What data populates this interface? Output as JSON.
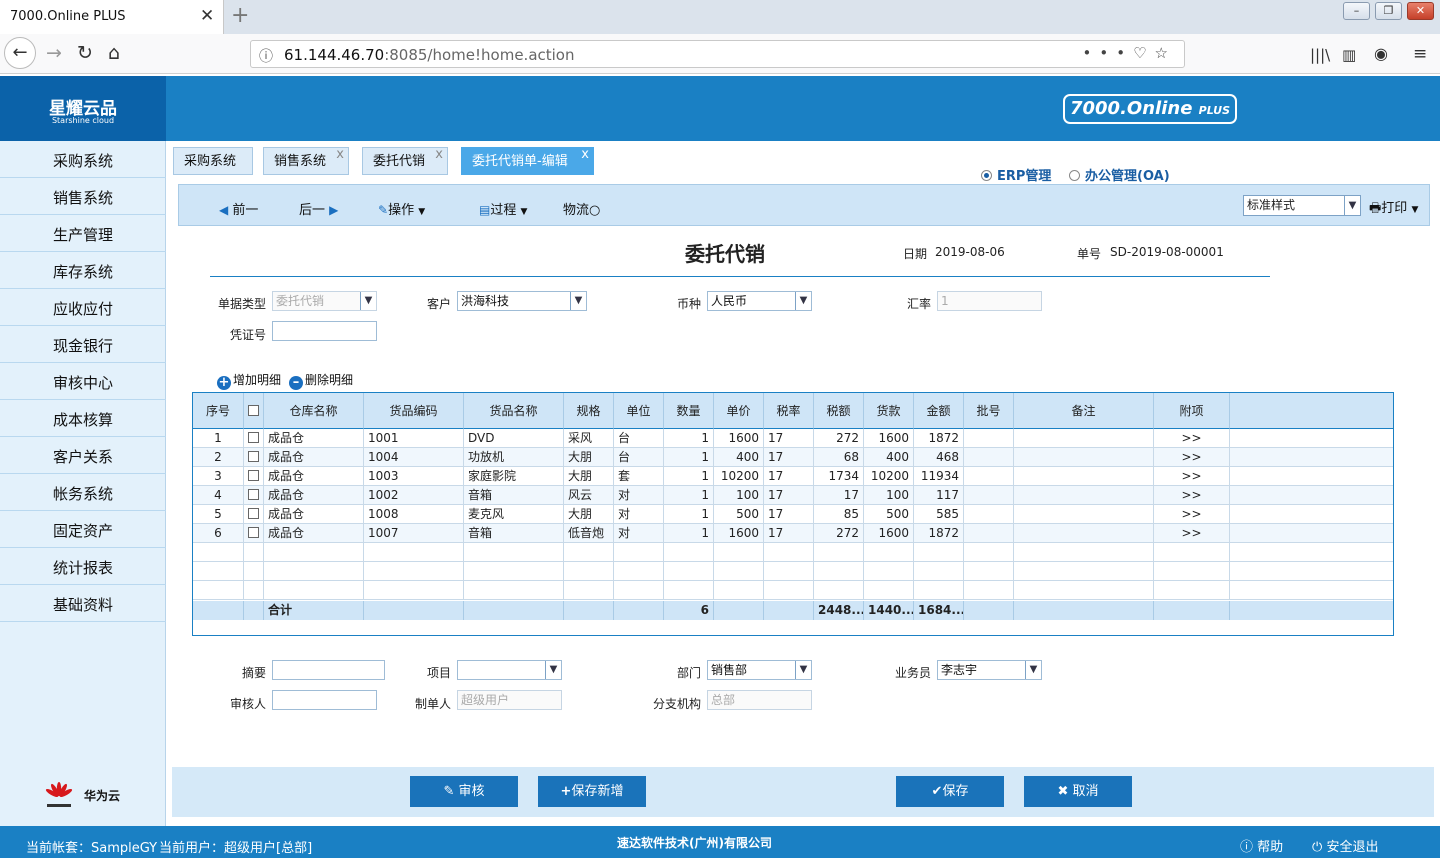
{
  "browser": {
    "tab_title": "7000.Online PLUS",
    "url_host": "61.144.46.70",
    "url_rest": ":8085/home!home.action"
  },
  "app": {
    "logo_cn": "星耀云品",
    "logo_en": "Starshine cloud",
    "brand_main": "7000.Online ",
    "brand_plus": "PLUS"
  },
  "sidebar": {
    "items": [
      "采购系统",
      "销售系统",
      "生产管理",
      "库存系统",
      "应收应付",
      "现金银行",
      "审核中心",
      "成本核算",
      "客户关系",
      "帐务系统",
      "固定资产",
      "统计报表",
      "基础资料"
    ],
    "footer_label": "华为云"
  },
  "tabs": [
    "采购系统",
    "销售系统",
    "委托代销",
    "委托代销单-编辑"
  ],
  "modes": {
    "erp": "ERP管理",
    "oa": "办公管理(OA)"
  },
  "toolbar": {
    "prev": "前一",
    "next": "后一",
    "operate": "操作",
    "process": "过程",
    "logistics": "物流",
    "style_value": "标准样式",
    "print": "打印"
  },
  "form": {
    "title": "委托代销",
    "date_label": "日期",
    "date_value": "2019-08-06",
    "no_label": "单号",
    "no_value": "SD-2019-08-00001",
    "doc_type_label": "单据类型",
    "doc_type_value": "委托代销",
    "customer_label": "客户",
    "customer_value": "洪海科技",
    "currency_label": "币种",
    "currency_value": "人民币",
    "rate_label": "汇率",
    "rate_value": "1",
    "voucher_label": "凭证号",
    "add_detail": "增加明细",
    "del_detail": "删除明细"
  },
  "grid": {
    "headers": [
      "序号",
      "",
      "仓库名称",
      "货品编码",
      "货品名称",
      "规格",
      "单位",
      "数量",
      "单价",
      "税率",
      "税额",
      "货款",
      "金额",
      "批号",
      "备注",
      "附项"
    ],
    "rows": [
      [
        "1",
        "",
        "成品仓",
        "1001",
        "DVD",
        "采风",
        "台",
        "1",
        "1600",
        "17",
        "272",
        "1600",
        "1872",
        "",
        "",
        ">>"
      ],
      [
        "2",
        "",
        "成品仓",
        "1004",
        "功放机",
        "大朋",
        "台",
        "1",
        "400",
        "17",
        "68",
        "400",
        "468",
        "",
        "",
        ">>"
      ],
      [
        "3",
        "",
        "成品仓",
        "1003",
        "家庭影院",
        "大朋",
        "套",
        "1",
        "10200",
        "17",
        "1734",
        "10200",
        "11934",
        "",
        "",
        ">>"
      ],
      [
        "4",
        "",
        "成品仓",
        "1002",
        "音箱",
        "风云",
        "对",
        "1",
        "100",
        "17",
        "17",
        "100",
        "117",
        "",
        "",
        ">>"
      ],
      [
        "5",
        "",
        "成品仓",
        "1008",
        "麦克风",
        "大朋",
        "对",
        "1",
        "500",
        "17",
        "85",
        "500",
        "585",
        "",
        "",
        ">>"
      ],
      [
        "6",
        "",
        "成品仓",
        "1007",
        "音箱",
        "低音炮",
        "对",
        "1",
        "1600",
        "17",
        "272",
        "1600",
        "1872",
        "",
        "",
        ">>"
      ]
    ],
    "footer": {
      "label": "合计",
      "qty": "6",
      "tax": "2448...",
      "goods": "1440...",
      "amount": "1684..."
    }
  },
  "bottom_form": {
    "summary_label": "摘要",
    "project_label": "项目",
    "dept_label": "部门",
    "dept_value": "销售部",
    "salesman_label": "业务员",
    "salesman_value": "李志宇",
    "reviewer_label": "审核人",
    "maker_label": "制单人",
    "maker_value": "超级用户",
    "branch_label": "分支机构",
    "branch_value": "总部"
  },
  "actions": {
    "review": "审核",
    "save_new": "保存新增",
    "save": "保存",
    "cancel": "取消"
  },
  "status": {
    "account": "当前帐套：SampleGY",
    "user": "当前用户：超级用户[总部]",
    "company": "速达软件技术(广州)有限公司",
    "help": "帮助",
    "logout": "安全退出"
  }
}
